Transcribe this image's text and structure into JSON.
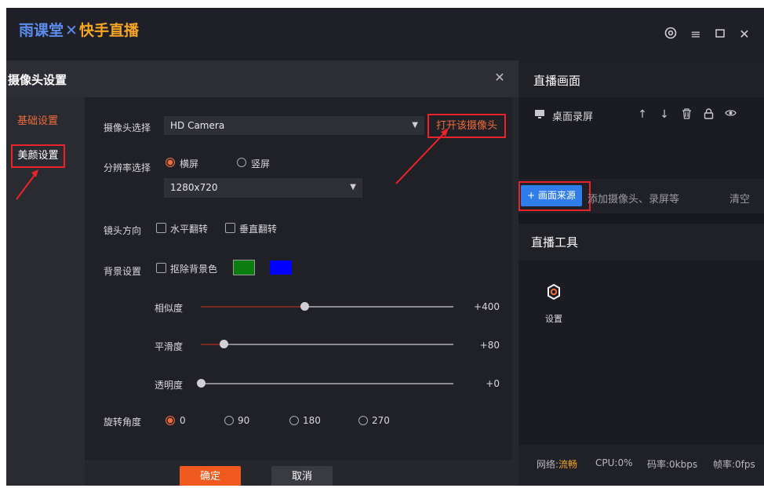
{
  "app": {
    "logo_part1": "雨课堂",
    "logo_sep": "✕",
    "logo_part2": "快手直播",
    "icons": [
      "settings-icon",
      "menu-icon",
      "maximize-icon",
      "close-icon"
    ]
  },
  "dialog": {
    "title": "摄像头设置",
    "sidebar": [
      "基础设置",
      "美颜设置"
    ],
    "camera_label": "摄像头选择",
    "camera_value": "HD Camera",
    "open_camera": "打开该摄像头",
    "resolution_label": "分辨率选择",
    "orientation_options": [
      "横屏",
      "竖屏"
    ],
    "orientation_selected": "横屏",
    "resolution_value": "1280x720",
    "mirror_label": "镜头方向",
    "mirror_options": [
      "水平翻转",
      "垂直翻转"
    ],
    "bg_label": "背景设置",
    "bg_checkbox": "抠除背景色",
    "bg_colors": [
      "#0b7d10",
      "#0000ff"
    ],
    "sliders": [
      {
        "label": "相似度",
        "value": "+400",
        "level": 0.41
      },
      {
        "label": "平滑度",
        "value": "+80",
        "level": 0.09
      },
      {
        "label": "透明度",
        "value": "+0",
        "level": 0.0
      }
    ],
    "rotation_label": "旋转角度",
    "rotation_options": [
      "0",
      "90",
      "180",
      "270"
    ],
    "rotation_selected": "0",
    "ok": "确定",
    "cancel": "取消"
  },
  "right_panel": {
    "title": "直播画面",
    "source_name": "桌面录屏",
    "source_icons": [
      "monitor-icon",
      "arrow-up-icon",
      "arrow-down-icon",
      "trash-icon",
      "lock-icon",
      "eye-icon"
    ],
    "add_button": "+ 画面来源",
    "add_hint": "添加摄像头、录屏等",
    "clear": "清空",
    "tools_title": "直播工具",
    "tool_settings": "设置",
    "status": {
      "network_label": "网络:",
      "network_value": "流畅",
      "cpu": "CPU:0%",
      "bitrate": "码率:0kbps",
      "fps": "帧率:0fps"
    }
  },
  "colors": {
    "accent": "#f06a3a",
    "primary_blue": "#2f7de9",
    "highlight_red": "#e8232a"
  }
}
